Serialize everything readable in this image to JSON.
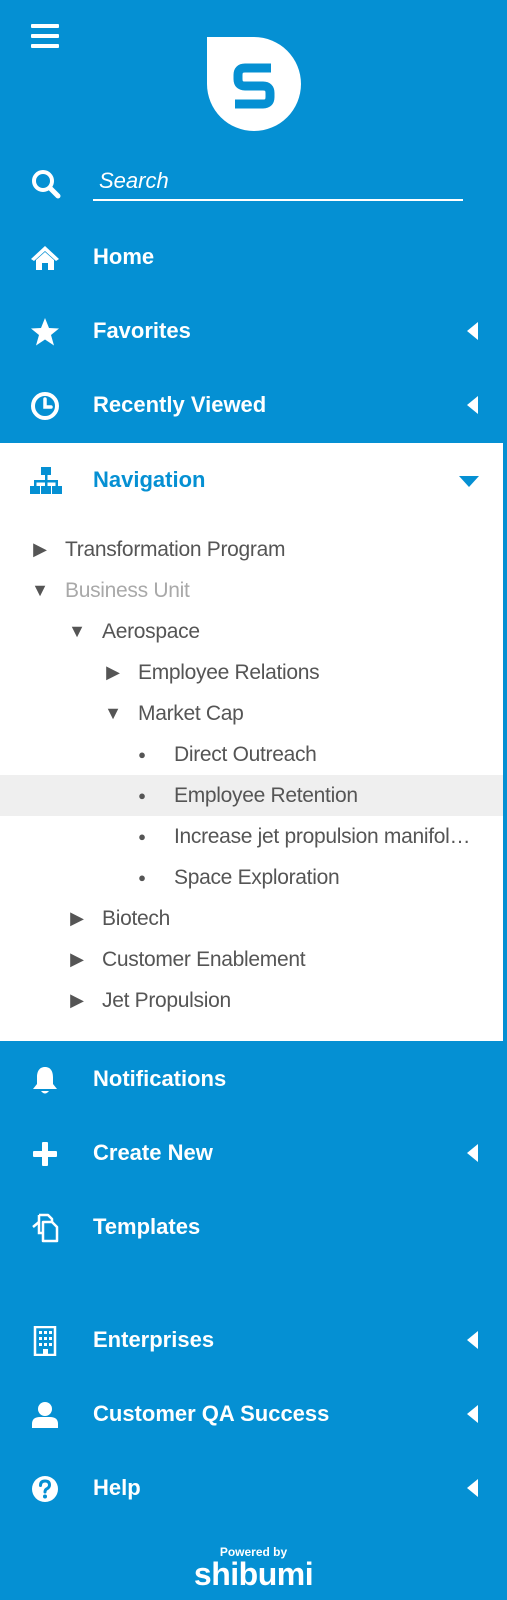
{
  "header": {
    "menu_icon": "hamburger-icon",
    "logo_icon": "shibumi-s-logo"
  },
  "search": {
    "placeholder": "Search",
    "value": ""
  },
  "menu_top": [
    {
      "label": "Home",
      "icon": "home-icon",
      "has_caret": false
    },
    {
      "label": "Favorites",
      "icon": "star-icon",
      "has_caret": true
    },
    {
      "label": "Recently Viewed",
      "icon": "clock-icon",
      "has_caret": true
    }
  ],
  "navigation": {
    "label": "Navigation",
    "icon": "sitemap-icon",
    "expanded": true,
    "tree": [
      {
        "label": "Transformation Program",
        "marker": "collapsed",
        "depth": 0,
        "muted": false,
        "selected": false
      },
      {
        "label": "Business Unit",
        "marker": "expanded",
        "depth": 0,
        "muted": true,
        "selected": false
      },
      {
        "label": "Aerospace",
        "marker": "expanded",
        "depth": 1,
        "muted": false,
        "selected": false
      },
      {
        "label": "Employee Relations",
        "marker": "collapsed",
        "depth": 2,
        "muted": false,
        "selected": false
      },
      {
        "label": "Market Cap",
        "marker": "expanded",
        "depth": 2,
        "muted": false,
        "selected": false
      },
      {
        "label": "Direct Outreach",
        "marker": "leaf",
        "depth": 3,
        "muted": false,
        "selected": false
      },
      {
        "label": "Employee Retention",
        "marker": "leaf",
        "depth": 3,
        "muted": false,
        "selected": true
      },
      {
        "label": "Increase jet propulsion manifol…",
        "marker": "leaf",
        "depth": 3,
        "muted": false,
        "selected": false
      },
      {
        "label": "Space Exploration",
        "marker": "leaf",
        "depth": 3,
        "muted": false,
        "selected": false
      },
      {
        "label": "Biotech",
        "marker": "collapsed",
        "depth": 1,
        "muted": false,
        "selected": false
      },
      {
        "label": "Customer Enablement",
        "marker": "collapsed",
        "depth": 1,
        "muted": false,
        "selected": false
      },
      {
        "label": "Jet Propulsion",
        "marker": "collapsed",
        "depth": 1,
        "muted": false,
        "selected": false
      }
    ]
  },
  "menu_mid": [
    {
      "label": "Notifications",
      "icon": "bell-icon",
      "has_caret": false
    },
    {
      "label": "Create New",
      "icon": "plus-icon",
      "has_caret": true
    },
    {
      "label": "Templates",
      "icon": "copy-icon",
      "has_caret": false
    }
  ],
  "menu_bottom": [
    {
      "label": "Enterprises",
      "icon": "building-icon",
      "has_caret": true
    },
    {
      "label": "Customer QA Success",
      "icon": "user-icon",
      "has_caret": true
    },
    {
      "label": "Help",
      "icon": "question-icon",
      "has_caret": true
    }
  ],
  "footer": {
    "powered_by": "Powered by",
    "brand": "shibumi"
  },
  "colors": {
    "sidebar_bg": "#0590d3",
    "panel_bg": "#ffffff",
    "accent": "#0590d3",
    "tree_text": "#555555",
    "tree_muted": "#a9a9a9",
    "selected_row": "#efefef"
  }
}
